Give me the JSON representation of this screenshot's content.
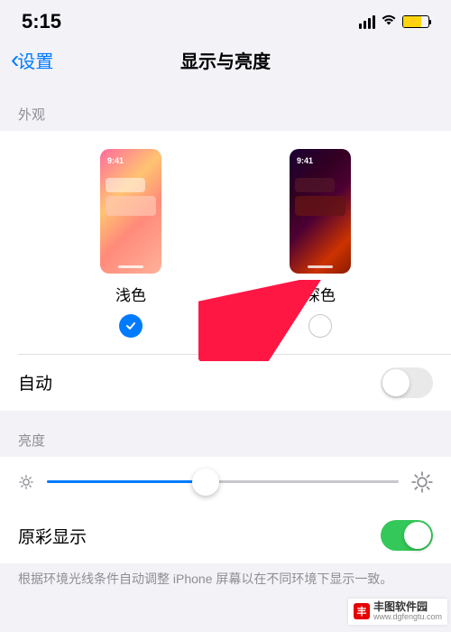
{
  "status": {
    "time": "5:15"
  },
  "nav": {
    "back_label": "设置",
    "title": "显示与亮度"
  },
  "appearance": {
    "header": "外观",
    "light_label": "浅色",
    "dark_label": "深色",
    "preview_time": "9:41",
    "selected": "light"
  },
  "auto": {
    "label": "自动",
    "enabled": false
  },
  "brightness": {
    "header": "亮度",
    "value": 45
  },
  "true_tone": {
    "label": "原彩显示",
    "enabled": true,
    "description": "根据环境光线条件自动调整 iPhone 屏幕以在不同环境下显示一致。"
  },
  "watermark": {
    "title": "丰图软件园",
    "url": "www.dgfengtu.com"
  }
}
